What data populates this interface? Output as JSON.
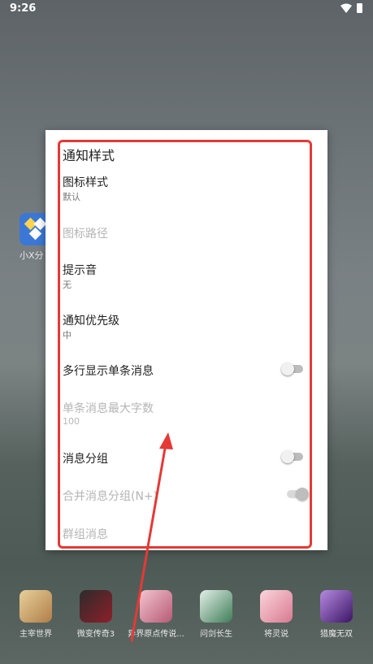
{
  "status_bar": {
    "time": "9:26"
  },
  "background_app": {
    "label": "小X分"
  },
  "dialog": {
    "title": "通知样式",
    "items": [
      {
        "title": "图标样式",
        "summary": "默认",
        "enabled": true
      },
      {
        "title": "图标路径",
        "enabled": false
      },
      {
        "title": "提示音",
        "summary": "无",
        "enabled": true
      },
      {
        "title": "通知优先级",
        "summary": "中",
        "enabled": true
      },
      {
        "title": "多行显示单条消息",
        "enabled": true,
        "switch": "off"
      },
      {
        "title": "单条消息最大字数",
        "summary": "100",
        "enabled": false
      },
      {
        "title": "消息分组",
        "enabled": true,
        "switch": "off"
      },
      {
        "title": "合并消息分组(N+)",
        "enabled": false,
        "switch": "on"
      },
      {
        "title": "群组消息",
        "enabled": false
      }
    ]
  },
  "dock": {
    "apps": [
      {
        "label": "主宰世界",
        "color": "#c9a36a"
      },
      {
        "label": "微变传奇3",
        "color": "#7a1c24"
      },
      {
        "label": "异界原点传说...",
        "color": "#d88aa0"
      },
      {
        "label": "问剑长生",
        "color": "#3f7d58"
      },
      {
        "label": "将灵说",
        "color": "#e7a0b0"
      },
      {
        "label": "猎魔无双",
        "color": "#5a2a8a"
      }
    ]
  },
  "annotation": {
    "color": "#e53935"
  }
}
